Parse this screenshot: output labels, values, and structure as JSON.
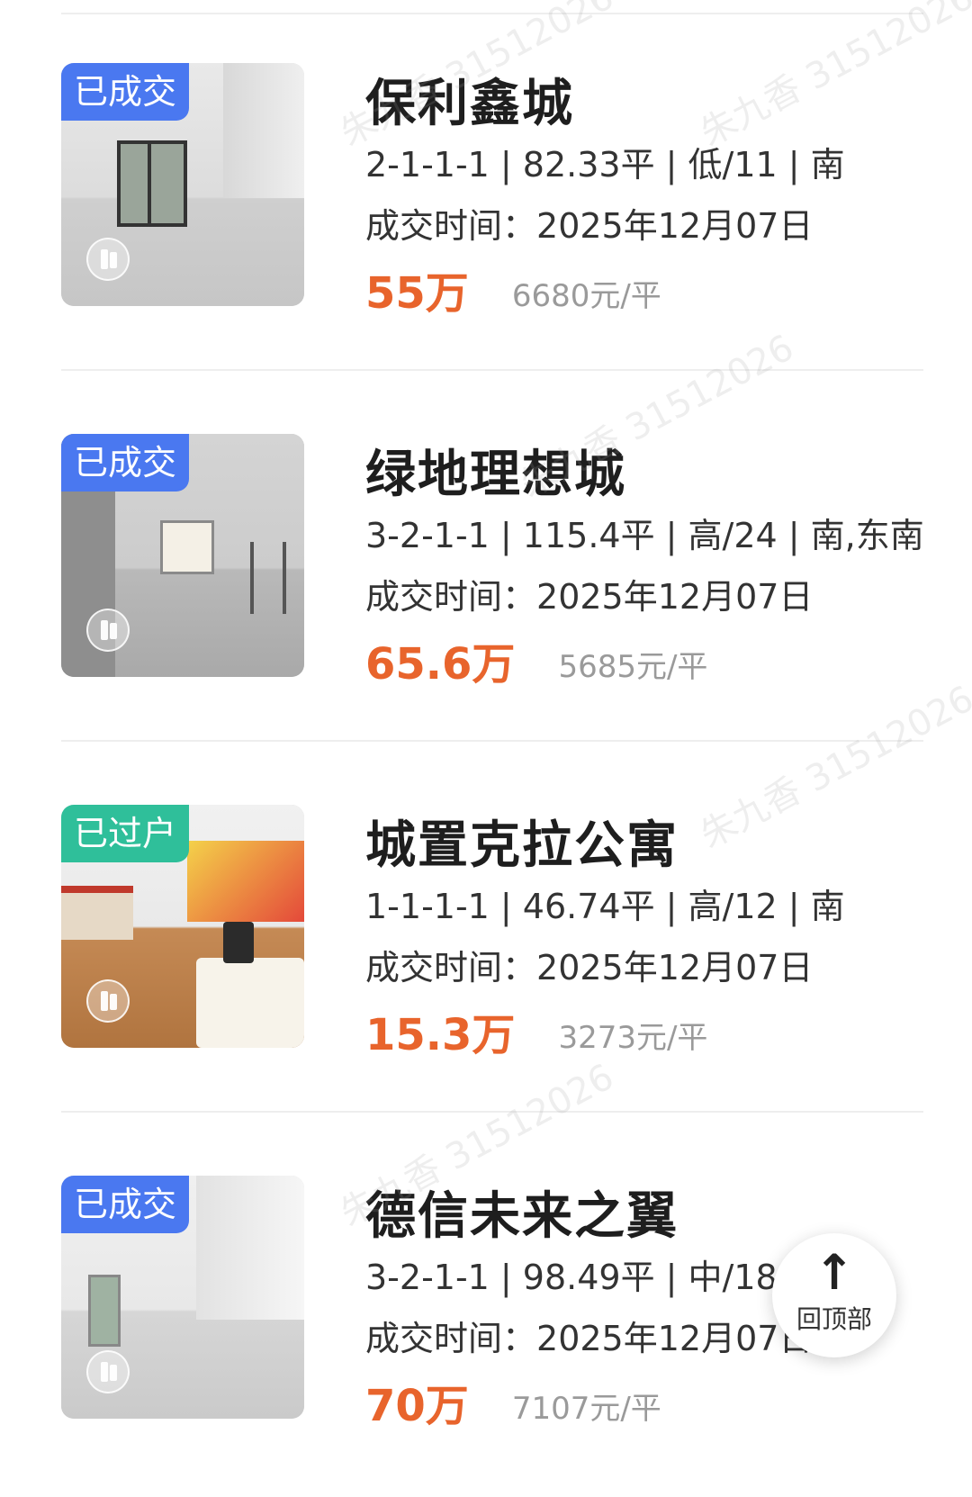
{
  "listings": [
    {
      "badge": "已成交",
      "name": "保利鑫城",
      "specs": "2-1-1-1 | 82.33平 | 低/11 | 南",
      "deal_label": "成交时间：",
      "deal_date": "2025年12月07日",
      "price": "55万",
      "unit_price": "6680元/平"
    },
    {
      "badge": "已成交",
      "name": "绿地理想城",
      "specs": "3-2-1-1 | 115.4平 | 高/24 | 南,东南",
      "deal_label": "成交时间：",
      "deal_date": "2025年12月07日",
      "price": "65.6万",
      "unit_price": "5685元/平"
    },
    {
      "badge": "已过户",
      "name": "城置克拉公寓",
      "specs": "1-1-1-1 | 46.74平 | 高/12 | 南",
      "deal_label": "成交时间：",
      "deal_date": "2025年12月07日",
      "price": "15.3万",
      "unit_price": "3273元/平"
    },
    {
      "badge": "已成交",
      "name": "德信未来之翼",
      "specs": "3-2-1-1 | 98.49平 | 中/18 |",
      "deal_label": "成交时间：",
      "deal_date": "2025年12月07日",
      "price": "70万",
      "unit_price": "7107元/平"
    }
  ],
  "back_to_top": {
    "arrow": "↑",
    "label": "回顶部"
  },
  "watermark": "朱九香 31512026",
  "colors": {
    "badge_sold": "#4a78f0",
    "badge_transferred": "#2fbf9a",
    "price": "#e8642c"
  }
}
